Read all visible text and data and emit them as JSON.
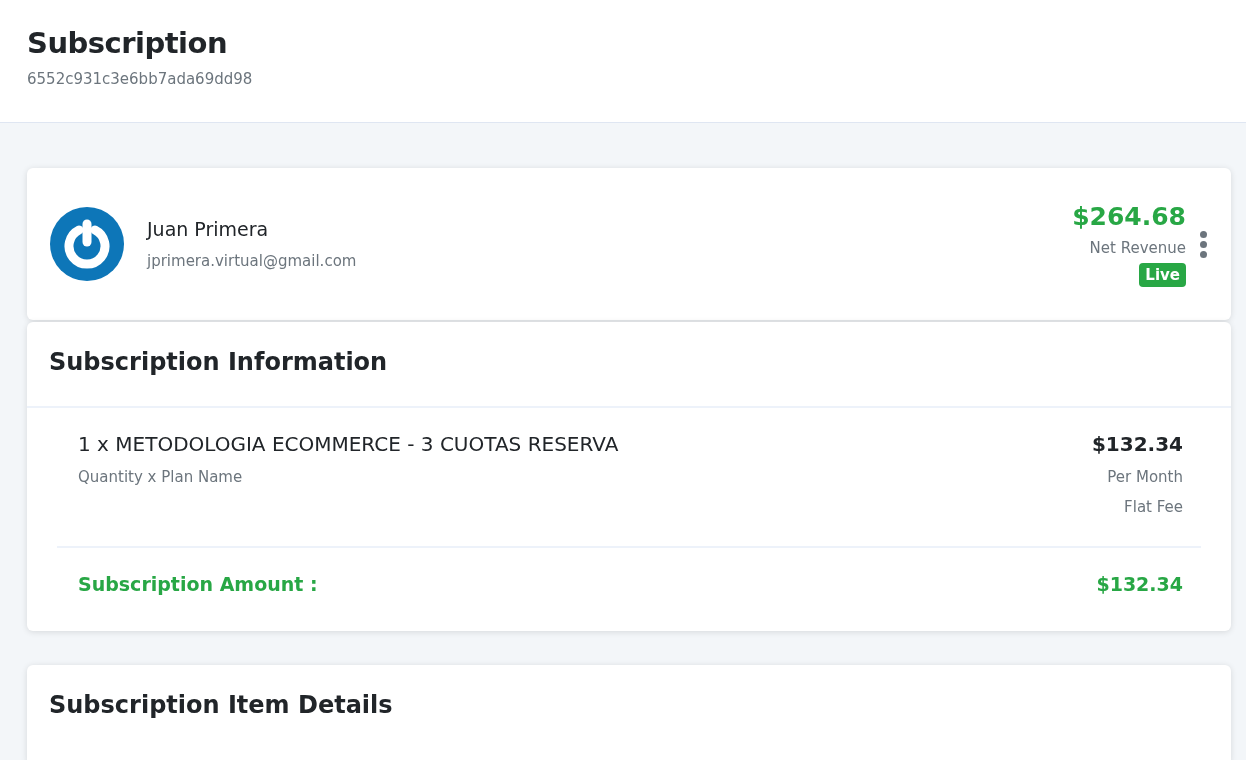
{
  "header": {
    "title": "Subscription",
    "id": "6552c931c3e6bb7ada69dd98"
  },
  "customer": {
    "name": "Juan Primera",
    "email": "jprimera.virtual@gmail.com",
    "revenue": "$264.68",
    "revenue_label": "Net Revenue",
    "status": "Live"
  },
  "information": {
    "title": "Subscription Information",
    "items": [
      {
        "name": "1 x METODOLOGIA ECOMMERCE - 3 CUOTAS RESERVA",
        "name_label": "Quantity x Plan Name",
        "price": "$132.34",
        "period": "Per Month",
        "fee": "Flat Fee"
      }
    ],
    "total_label": "Subscription Amount :",
    "total": "$132.34"
  },
  "item_details": {
    "title": "Subscription Item Details"
  }
}
